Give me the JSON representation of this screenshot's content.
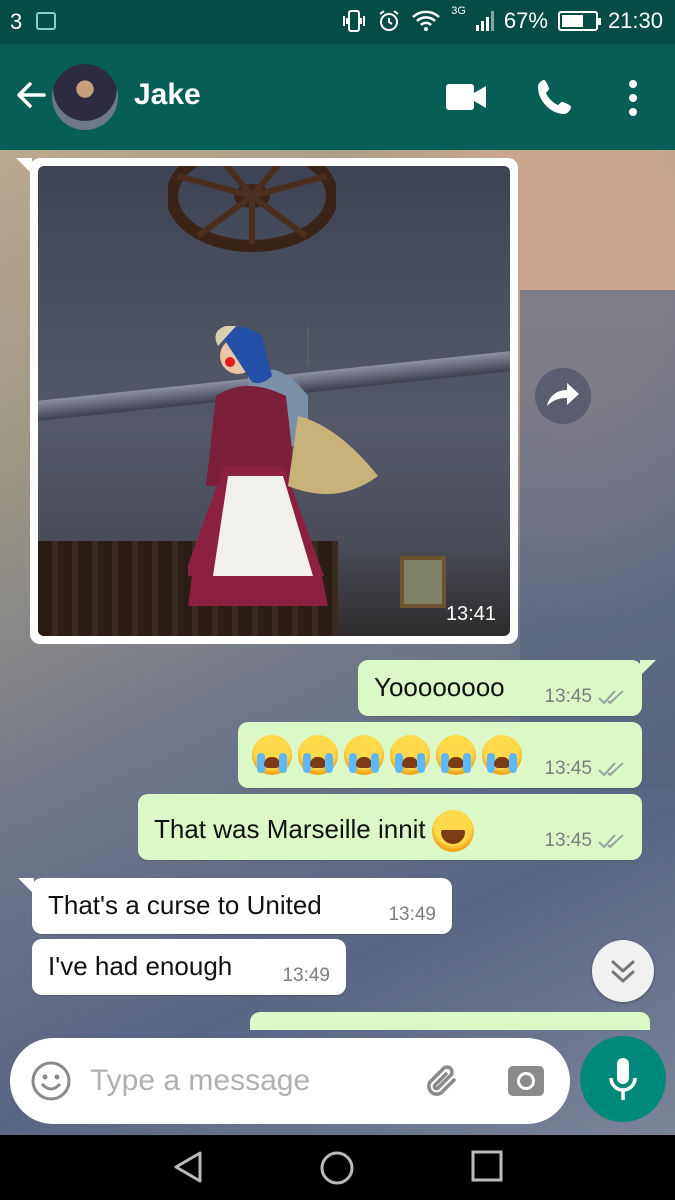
{
  "status_bar": {
    "carrier": "3",
    "network": "3G",
    "battery": "67%",
    "battery_level": 0.67,
    "time": "21:30"
  },
  "header": {
    "contact_name": "Jake"
  },
  "messages": [
    {
      "type": "image",
      "direction": "in",
      "time": "13:41"
    },
    {
      "type": "text",
      "direction": "out",
      "text": "Yoooooooo",
      "time": "13:45"
    },
    {
      "type": "emoji",
      "direction": "out",
      "emoji": "loudly-crying-face",
      "count": 6,
      "time": "13:45"
    },
    {
      "type": "text",
      "direction": "out",
      "text": "That was Marseille innit",
      "emoji": "face-with-tears-of-joy",
      "time": "13:45"
    },
    {
      "type": "text",
      "direction": "in",
      "text": "That's a curse to United",
      "time": "13:49"
    },
    {
      "type": "text",
      "direction": "in",
      "text": "I've had enough",
      "time": "13:49"
    }
  ],
  "input": {
    "placeholder": "Type a message"
  },
  "colors": {
    "header": "#075e54",
    "status_bar": "#054d44",
    "outgoing_bubble": "#dcf8c6",
    "incoming_bubble": "#ffffff",
    "mic_button": "#00897b"
  }
}
